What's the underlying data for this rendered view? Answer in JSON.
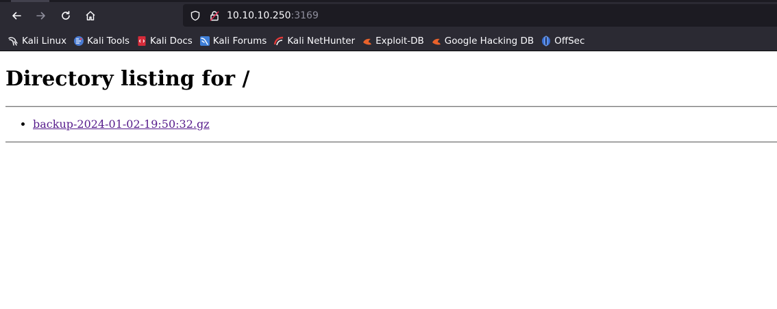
{
  "browser": {
    "url_host": "10.10.10.250",
    "url_port": ":3169"
  },
  "bookmarks": [
    {
      "label": "Kali Linux",
      "icon": "kali-dragon-icon"
    },
    {
      "label": "Kali Tools",
      "icon": "kali-tools-icon"
    },
    {
      "label": "Kali Docs",
      "icon": "kali-docs-icon"
    },
    {
      "label": "Kali Forums",
      "icon": "kali-forums-icon"
    },
    {
      "label": "Kali NetHunter",
      "icon": "kali-nethunter-icon"
    },
    {
      "label": "Exploit-DB",
      "icon": "exploit-db-icon"
    },
    {
      "label": "Google Hacking DB",
      "icon": "google-hacking-db-icon"
    },
    {
      "label": "OffSec",
      "icon": "offsec-icon"
    }
  ],
  "page": {
    "heading": "Directory listing for /",
    "files": [
      {
        "name": "backup-2024-01-02-19:50:32.gz"
      }
    ]
  }
}
